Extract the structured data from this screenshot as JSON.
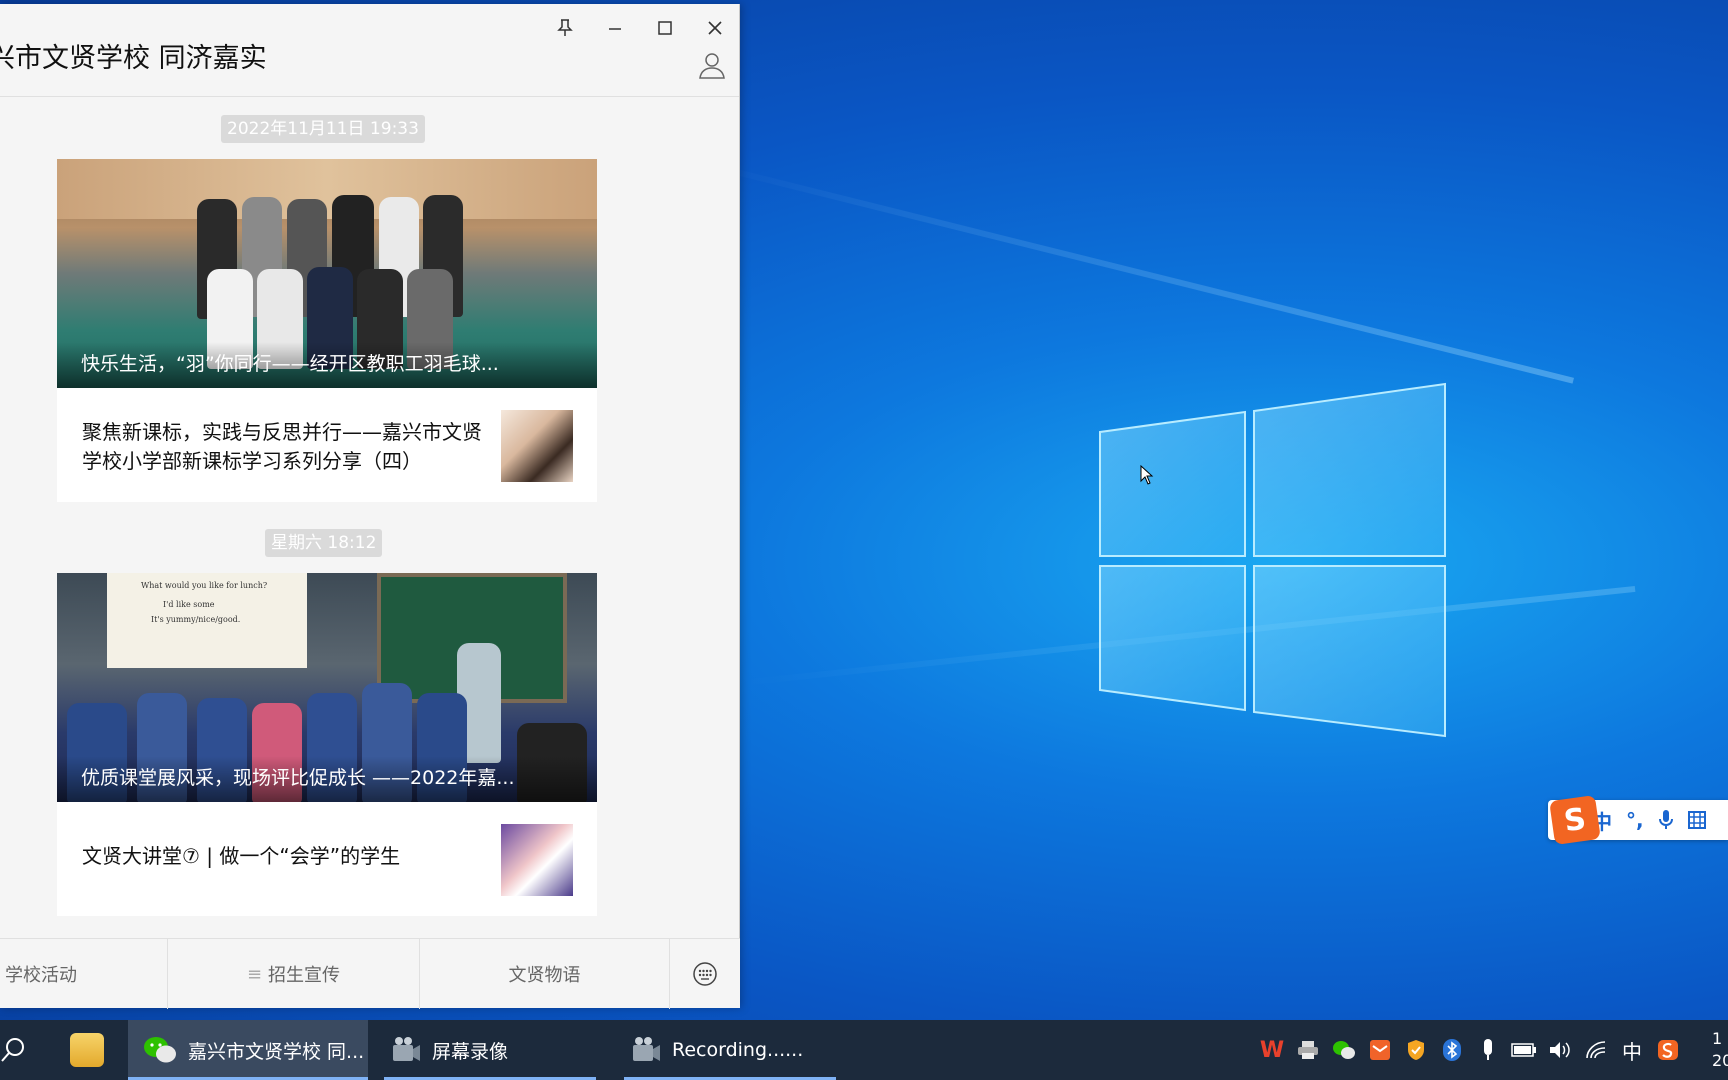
{
  "chat": {
    "title": "兴市文贤学校 同济嘉实",
    "messages": [
      {
        "time": "2022年11月11日  19:33",
        "cover_caption": "快乐生活，“羽”你同行——经开区教职工羽毛球...",
        "item_text": "聚焦新课标，实践与反思并行——嘉兴市文贤学校小学部新课标学习系列分享（四）"
      },
      {
        "time": "星期六  18:12",
        "cover_caption": "优质课堂展风采，现场评比促成长 ——2022年嘉...",
        "item_text": "文贤大讲堂⑦ | 做一个“会学”的学生"
      }
    ],
    "menu": {
      "item1": "学校活动",
      "item2": "招生宣传",
      "item3": "文贤物语"
    }
  },
  "classroom_screen": {
    "line1": "What would you like for lunch?",
    "line2": "I'd like some",
    "line3": "It's yummy/nice/good."
  },
  "ime": {
    "logo": "S",
    "mode": "中",
    "punct": "°,"
  },
  "taskbar": {
    "apps": [
      {
        "label": "嘉兴市文贤学校 同...",
        "active": true
      },
      {
        "label": "屏幕录像",
        "active": false
      },
      {
        "label": "Recording......",
        "active": false
      }
    ],
    "tray_lang": "中",
    "clock_line1": "1",
    "clock_line2": "20"
  },
  "colors": {
    "taskbar_bg": "#1c2a3c",
    "wechat_green": "#2dc100",
    "accent_blue": "#7fb2f5"
  }
}
